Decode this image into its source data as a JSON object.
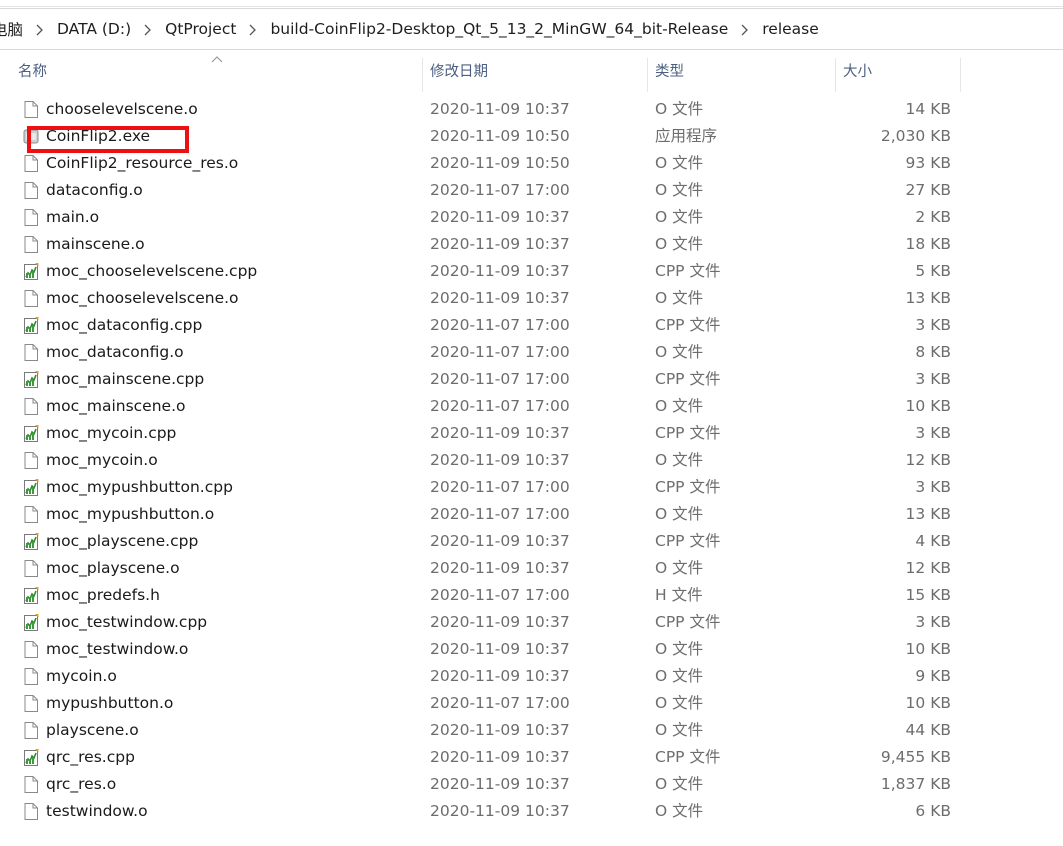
{
  "breadcrumb": {
    "items": [
      "电脑",
      "DATA (D:)",
      "QtProject",
      "build-CoinFlip2-Desktop_Qt_5_13_2_MinGW_64_bit-Release",
      "release"
    ]
  },
  "columns": {
    "name": "名称",
    "date": "修改日期",
    "type": "类型",
    "size": "大小"
  },
  "files": [
    {
      "name": "chooselevelscene.o",
      "date": "2020-11-09 10:37",
      "type": "O 文件",
      "size": "14 KB",
      "icon": "blank-file-icon"
    },
    {
      "name": "CoinFlip2.exe",
      "date": "2020-11-09 10:50",
      "type": "应用程序",
      "size": "2,030 KB",
      "icon": "exe-icon"
    },
    {
      "name": "CoinFlip2_resource_res.o",
      "date": "2020-11-09 10:50",
      "type": "O 文件",
      "size": "93 KB",
      "icon": "blank-file-icon"
    },
    {
      "name": "dataconfig.o",
      "date": "2020-11-07 17:00",
      "type": "O 文件",
      "size": "27 KB",
      "icon": "blank-file-icon"
    },
    {
      "name": "main.o",
      "date": "2020-11-09 10:37",
      "type": "O 文件",
      "size": "2 KB",
      "icon": "blank-file-icon"
    },
    {
      "name": "mainscene.o",
      "date": "2020-11-09 10:37",
      "type": "O 文件",
      "size": "18 KB",
      "icon": "blank-file-icon"
    },
    {
      "name": "moc_chooselevelscene.cpp",
      "date": "2020-11-09 10:37",
      "type": "CPP 文件",
      "size": "5 KB",
      "icon": "cpp-file-icon"
    },
    {
      "name": "moc_chooselevelscene.o",
      "date": "2020-11-09 10:37",
      "type": "O 文件",
      "size": "13 KB",
      "icon": "blank-file-icon"
    },
    {
      "name": "moc_dataconfig.cpp",
      "date": "2020-11-07 17:00",
      "type": "CPP 文件",
      "size": "3 KB",
      "icon": "cpp-file-icon"
    },
    {
      "name": "moc_dataconfig.o",
      "date": "2020-11-07 17:00",
      "type": "O 文件",
      "size": "8 KB",
      "icon": "blank-file-icon"
    },
    {
      "name": "moc_mainscene.cpp",
      "date": "2020-11-07 17:00",
      "type": "CPP 文件",
      "size": "3 KB",
      "icon": "cpp-file-icon"
    },
    {
      "name": "moc_mainscene.o",
      "date": "2020-11-07 17:00",
      "type": "O 文件",
      "size": "10 KB",
      "icon": "blank-file-icon"
    },
    {
      "name": "moc_mycoin.cpp",
      "date": "2020-11-09 10:37",
      "type": "CPP 文件",
      "size": "3 KB",
      "icon": "cpp-file-icon"
    },
    {
      "name": "moc_mycoin.o",
      "date": "2020-11-09 10:37",
      "type": "O 文件",
      "size": "12 KB",
      "icon": "blank-file-icon"
    },
    {
      "name": "moc_mypushbutton.cpp",
      "date": "2020-11-07 17:00",
      "type": "CPP 文件",
      "size": "3 KB",
      "icon": "cpp-file-icon"
    },
    {
      "name": "moc_mypushbutton.o",
      "date": "2020-11-07 17:00",
      "type": "O 文件",
      "size": "13 KB",
      "icon": "blank-file-icon"
    },
    {
      "name": "moc_playscene.cpp",
      "date": "2020-11-09 10:37",
      "type": "CPP 文件",
      "size": "4 KB",
      "icon": "cpp-file-icon"
    },
    {
      "name": "moc_playscene.o",
      "date": "2020-11-09 10:37",
      "type": "O 文件",
      "size": "12 KB",
      "icon": "blank-file-icon"
    },
    {
      "name": "moc_predefs.h",
      "date": "2020-11-07 17:00",
      "type": "H 文件",
      "size": "15 KB",
      "icon": "cpp-file-icon"
    },
    {
      "name": "moc_testwindow.cpp",
      "date": "2020-11-09 10:37",
      "type": "CPP 文件",
      "size": "3 KB",
      "icon": "cpp-file-icon"
    },
    {
      "name": "moc_testwindow.o",
      "date": "2020-11-09 10:37",
      "type": "O 文件",
      "size": "10 KB",
      "icon": "blank-file-icon"
    },
    {
      "name": "mycoin.o",
      "date": "2020-11-09 10:37",
      "type": "O 文件",
      "size": "9 KB",
      "icon": "blank-file-icon"
    },
    {
      "name": "mypushbutton.o",
      "date": "2020-11-07 17:00",
      "type": "O 文件",
      "size": "10 KB",
      "icon": "blank-file-icon"
    },
    {
      "name": "playscene.o",
      "date": "2020-11-09 10:37",
      "type": "O 文件",
      "size": "44 KB",
      "icon": "blank-file-icon"
    },
    {
      "name": "qrc_res.cpp",
      "date": "2020-11-09 10:37",
      "type": "CPP 文件",
      "size": "9,455 KB",
      "icon": "cpp-file-icon"
    },
    {
      "name": "qrc_res.o",
      "date": "2020-11-09 10:37",
      "type": "O 文件",
      "size": "1,837 KB",
      "icon": "blank-file-icon"
    },
    {
      "name": "testwindow.o",
      "date": "2020-11-09 10:37",
      "type": "O 文件",
      "size": "6 KB",
      "icon": "blank-file-icon"
    }
  ],
  "colors": {
    "highlight": "#ee1010",
    "header_text": "#4d6082",
    "secondary_text": "#6d6d6d"
  }
}
